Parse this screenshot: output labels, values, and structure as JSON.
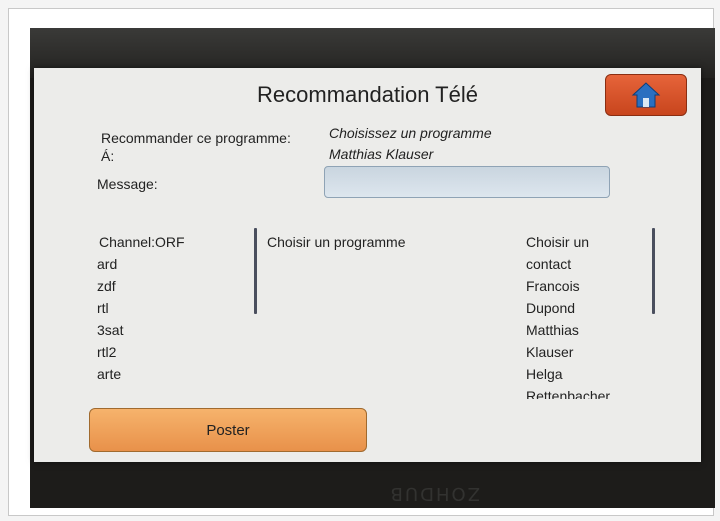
{
  "header": {
    "title": "Recommandation Télé"
  },
  "form": {
    "recommend_label": "Recommander ce programme:",
    "recommend_value": "Choisissez un programme",
    "to_label": "Á:",
    "to_value": "Matthias Klauser",
    "message_label": "Message:",
    "message_value": ""
  },
  "channels": {
    "items": [
      "Channel:ORF",
      "ard",
      "zdf",
      "rtl",
      "3sat",
      "rtl2",
      "arte"
    ]
  },
  "programs": {
    "placeholder": "Choisir un programme"
  },
  "contacts": {
    "header": [
      "Choisir un",
      "contact"
    ],
    "items": [
      "Francois",
      "Dupond",
      "Matthias",
      "Klauser",
      "Helga",
      "Rettenbacher"
    ]
  },
  "actions": {
    "poster_label": "Poster"
  },
  "bezel": {
    "reflection_text": "ZOHDUB"
  },
  "colors": {
    "home_button": "#d5532a",
    "poster_button": "#f0a35a",
    "input_bg": "#d3dde6",
    "screen_bg": "#ececea"
  },
  "icons": {
    "home": "home-icon"
  }
}
